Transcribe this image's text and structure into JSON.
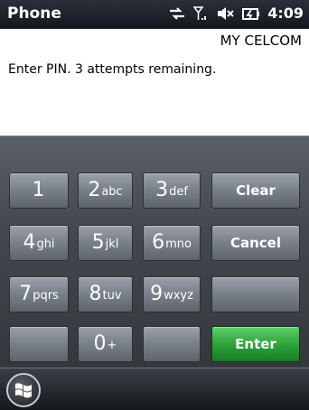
{
  "titlebar": {
    "app_title": "Phone",
    "time": "4:09",
    "icons": [
      "data-transfer-icon",
      "signal-icon",
      "volume-mute-icon",
      "battery-charging-icon"
    ]
  },
  "content": {
    "operator": "MY CELCOM",
    "prompt": "Enter PIN. 3 attempts remaining."
  },
  "keypad": {
    "keys": [
      {
        "digit": "1",
        "letters": ""
      },
      {
        "digit": "2",
        "letters": "abc"
      },
      {
        "digit": "3",
        "letters": "def"
      },
      {
        "digit": "4",
        "letters": "ghi"
      },
      {
        "digit": "5",
        "letters": "jkl"
      },
      {
        "digit": "6",
        "letters": "mno"
      },
      {
        "digit": "7",
        "letters": "pqrs"
      },
      {
        "digit": "8",
        "letters": "tuv"
      },
      {
        "digit": "9",
        "letters": "wxyz"
      },
      {
        "digit": "0",
        "letters": "+"
      }
    ],
    "clear_label": "Clear",
    "cancel_label": "Cancel",
    "enter_label": "Enter"
  },
  "bottombar": {
    "start_icon": "windows-start-icon"
  },
  "colors": {
    "enter_green": "#2fa33c",
    "key_gray": "#7b828b",
    "title_bar": "#1d2128"
  }
}
